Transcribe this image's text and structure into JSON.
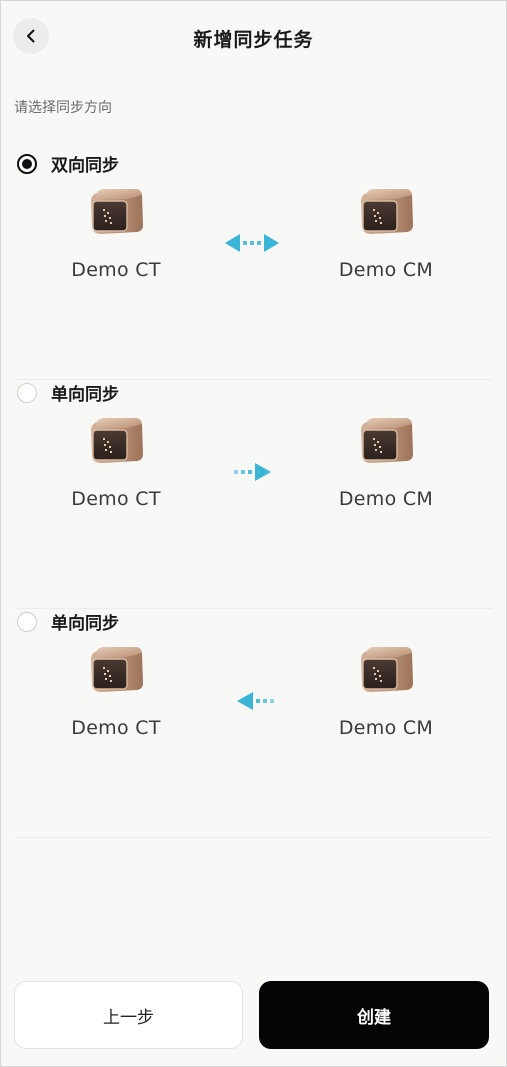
{
  "header": {
    "title": "新增同步任务"
  },
  "prompt": "请选择同步方向",
  "options": [
    {
      "label": "双向同步",
      "selected": true,
      "direction": "bidirectional",
      "source": "Demo CT",
      "target": "Demo CM"
    },
    {
      "label": "单向同步",
      "selected": false,
      "direction": "right",
      "source": "Demo CT",
      "target": "Demo CM"
    },
    {
      "label": "单向同步",
      "selected": false,
      "direction": "left",
      "source": "Demo CT",
      "target": "Demo CM"
    }
  ],
  "footer": {
    "prev_label": "上一步",
    "create_label": "创建"
  },
  "colors": {
    "accent_arrow": "#3ab5d8",
    "primary_button": "#050505",
    "device_body": "#c9a48a"
  }
}
